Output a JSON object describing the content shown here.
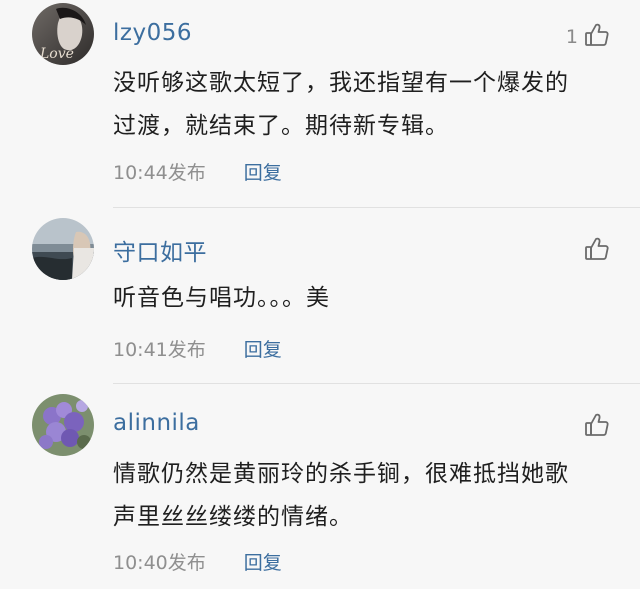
{
  "comments": [
    {
      "username": "lzy056",
      "like_count": "1",
      "lines": [
        "没听够这歌太短了，我还指望有一个爆发的",
        "过渡，就结束了。期待新专辑。"
      ],
      "time": "10:44发布",
      "reply": "回复",
      "avatar_text": "Love"
    },
    {
      "username": "守口如平",
      "like_count": "",
      "lines": [
        "听音色与唱功。。。美"
      ],
      "time": "10:41发布",
      "reply": "回复"
    },
    {
      "username": "alinnila",
      "like_count": "",
      "lines": [
        "情歌仍然是黄丽玲的杀手锏，很难抵挡她歌",
        "声里丝丝缕缕的情绪。"
      ],
      "time": "10:40发布",
      "reply": "回复"
    }
  ],
  "icons": {
    "like": "thumbs-up-icon"
  },
  "colors": {
    "background": "#f7f7f7",
    "username": "#3c6e9f",
    "reply": "#3c6e9f",
    "meta": "#8f8f8f"
  }
}
